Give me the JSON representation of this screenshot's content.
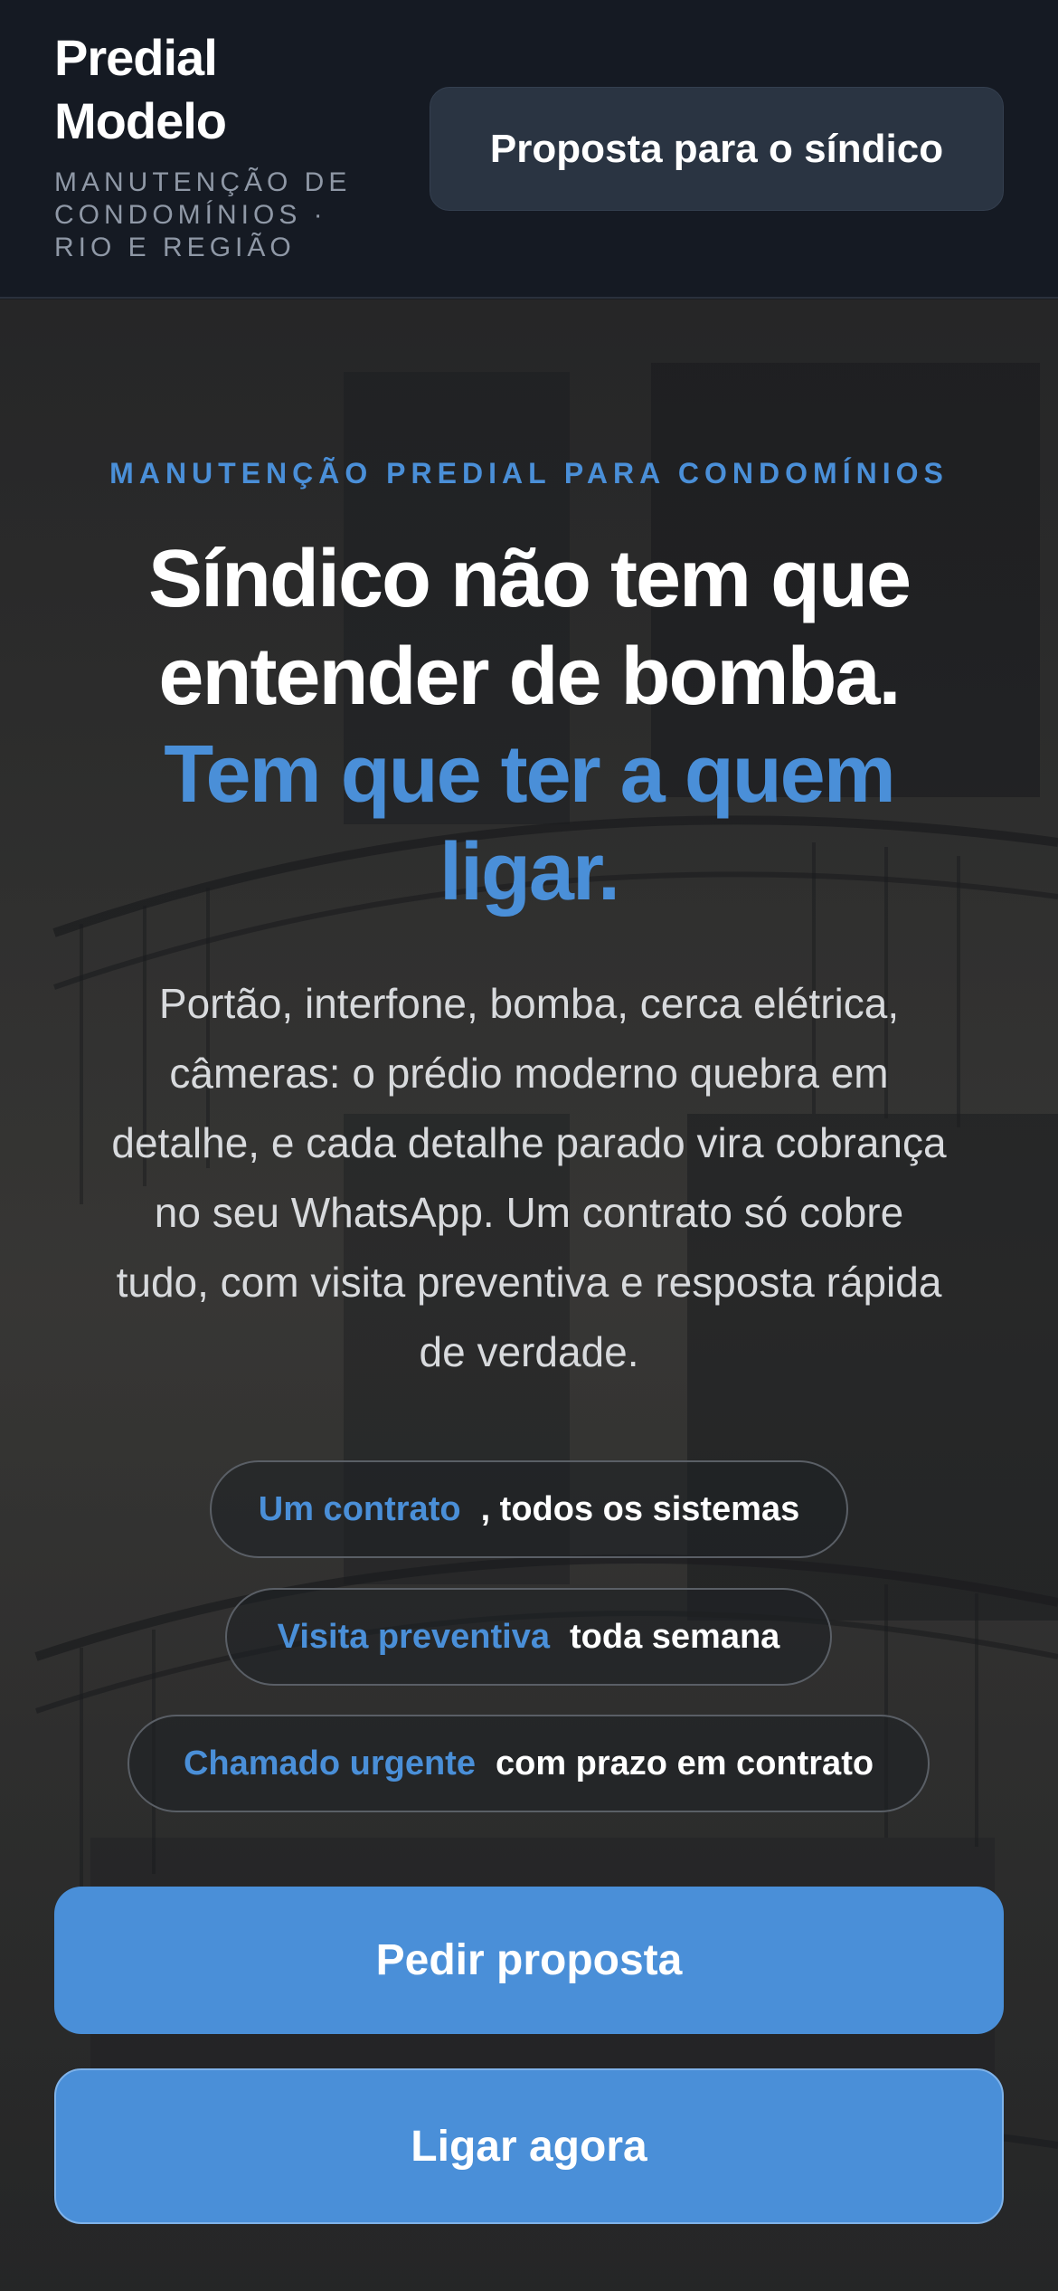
{
  "header": {
    "brand_line1": "Predial",
    "brand_line2": "Modelo",
    "tagline_line1": "MANUTENÇÃO DE",
    "tagline_line2": "CONDOMÍNIOS ·",
    "tagline_line3": "RIO E REGIÃO",
    "proposal_button": "Proposta para o síndico"
  },
  "hero": {
    "eyebrow": "MANUTENÇÃO PREDIAL PARA CONDOMÍNIOS",
    "headline_line1": "Síndico não tem que",
    "headline_line2": "entender de bomba.",
    "headline_accent_line1": "Tem que ter a quem",
    "headline_accent_line2": "ligar.",
    "lead_lines": [
      "Portão, interfone, bomba, cerca elétrica,",
      "câmeras: o prédio moderno quebra em",
      "detalhe, e cada detalhe parado vira cobrança",
      "no seu WhatsApp. Um contrato só cobre",
      "tudo, com visita preventiva e resposta rápida",
      "de verdade."
    ],
    "pills": [
      {
        "strong": "Um contrato",
        "rest": ", todos os sistemas"
      },
      {
        "strong": "Visita preventiva",
        "rest": "toda semana"
      },
      {
        "strong": "Chamado urgente",
        "rest": "com prazo em contrato"
      }
    ],
    "primary_cta": "Pedir proposta",
    "secondary_cta": "Ligar agora"
  },
  "colors": {
    "accent": "#4a8fd8",
    "header_bg": "#151a23",
    "button_bg": "#2a3442"
  }
}
